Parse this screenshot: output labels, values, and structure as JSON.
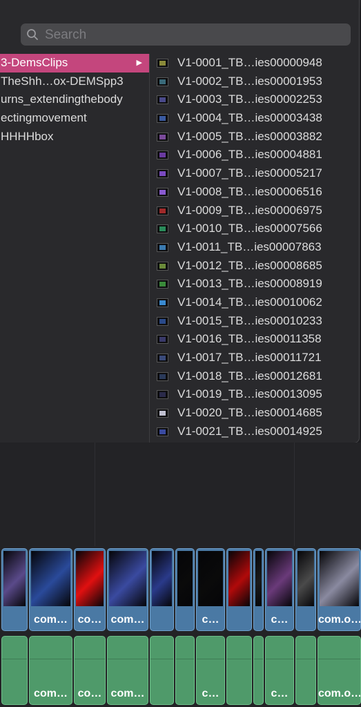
{
  "search": {
    "placeholder": "Search"
  },
  "folders": [
    {
      "label": "3-DemsClips",
      "selected": true
    },
    {
      "label": "TheShh…ox-DEMSpp3",
      "selected": false
    },
    {
      "label": "urns_extendingthebody",
      "selected": false
    },
    {
      "label": "ectingmovement",
      "selected": false
    },
    {
      "label": "HHHHbox",
      "selected": false
    }
  ],
  "clips": [
    {
      "label": "V1-0001_TB…ies00000948",
      "thumb_color": "#8a8a3a"
    },
    {
      "label": "V1-0002_TB…ies00001953",
      "thumb_color": "#3a6a7a"
    },
    {
      "label": "V1-0003_TB…ies00002253",
      "thumb_color": "#4a4a8a"
    },
    {
      "label": "V1-0004_TB…ies00003438",
      "thumb_color": "#3a5aa0"
    },
    {
      "label": "V1-0005_TB…ies00003882",
      "thumb_color": "#7a4a9a"
    },
    {
      "label": "V1-0006_TB…ies00004881",
      "thumb_color": "#6a3aa0"
    },
    {
      "label": "V1-0007_TB…ies00005217",
      "thumb_color": "#7a4ac0"
    },
    {
      "label": "V1-0008_TB…ies00006516",
      "thumb_color": "#8a5ad0"
    },
    {
      "label": "V1-0009_TB…ies00006975",
      "thumb_color": "#a02a2a"
    },
    {
      "label": "V1-0010_TB…ies00007566",
      "thumb_color": "#2a8a5a"
    },
    {
      "label": "V1-0011_TB…ies00007863",
      "thumb_color": "#3a7ab0"
    },
    {
      "label": "V1-0012_TB…ies00008685",
      "thumb_color": "#6a8a3a"
    },
    {
      "label": "V1-0013_TB…ies00008919",
      "thumb_color": "#3a8a3a"
    },
    {
      "label": "V1-0014_TB…ies00010062",
      "thumb_color": "#3a8ad0"
    },
    {
      "label": "V1-0015_TB…ies00010233",
      "thumb_color": "#2a4a8a"
    },
    {
      "label": "V1-0016_TB…ies00011358",
      "thumb_color": "#3a3a6a"
    },
    {
      "label": "V1-0017_TB…ies00011721",
      "thumb_color": "#3a4a7a"
    },
    {
      "label": "V1-0018_TB…ies00012681",
      "thumb_color": "#2a3a5a"
    },
    {
      "label": "V1-0019_TB…ies00013095",
      "thumb_color": "#2a2a4a"
    },
    {
      "label": "V1-0020_TB…ies00014685",
      "thumb_color": "#c0c0d0"
    },
    {
      "label": "V1-0021_TB…ies00014925",
      "thumb_color": "#3a4aa0"
    }
  ],
  "timeline": {
    "video_clips": [
      {
        "label": "",
        "bg": "#5a4a8a"
      },
      {
        "label": "com…",
        "bg": "#2a4a9a"
      },
      {
        "label": "co…",
        "bg": "#e01010"
      },
      {
        "label": "com…",
        "bg": "#3a4aa0"
      },
      {
        "label": "",
        "bg": "#2a3a8a"
      },
      {
        "label": "",
        "bg": "#0a0a0a"
      },
      {
        "label": "c…",
        "bg": "#0a0a0a"
      },
      {
        "label": "",
        "bg": "#b00a0a"
      },
      {
        "label": "",
        "bg": "#1a1a1a"
      },
      {
        "label": "c…",
        "bg": "#6a3a7a"
      },
      {
        "label": "",
        "bg": "#4a4a4a"
      },
      {
        "label": "com.o…",
        "bg": "#8a8aa0"
      }
    ],
    "audio_clips": [
      {
        "label": ""
      },
      {
        "label": "com…"
      },
      {
        "label": "co…"
      },
      {
        "label": "com…"
      },
      {
        "label": ""
      },
      {
        "label": ""
      },
      {
        "label": "c…"
      },
      {
        "label": ""
      },
      {
        "label": ""
      },
      {
        "label": "c…"
      },
      {
        "label": ""
      },
      {
        "label": "com.o…"
      }
    ]
  }
}
